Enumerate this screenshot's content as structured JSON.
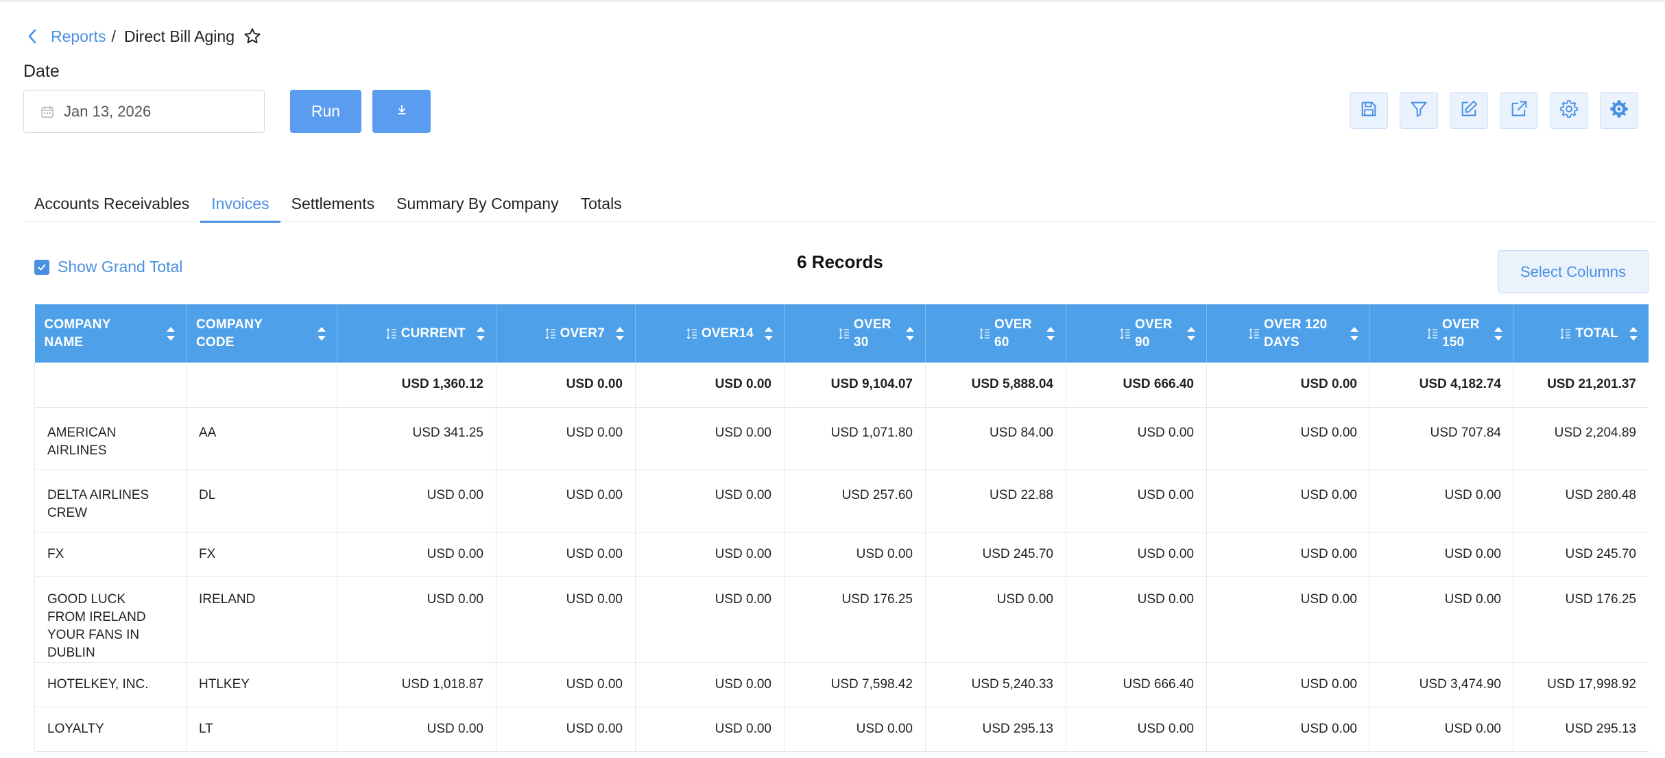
{
  "breadcrumb": {
    "parent": "Reports",
    "separator": "/",
    "current": "Direct Bill Aging"
  },
  "date": {
    "label": "Date",
    "value": "Jan 13, 2026"
  },
  "buttons": {
    "run": "Run"
  },
  "toolbar": [
    "save-icon",
    "filter-icon",
    "edit-icon",
    "external-link-icon",
    "gear-icon",
    "gear-badge-icon"
  ],
  "tabs": [
    {
      "label": "Accounts Receivables",
      "active": false
    },
    {
      "label": "Invoices",
      "active": true
    },
    {
      "label": "Settlements",
      "active": false
    },
    {
      "label": "Summary By Company",
      "active": false
    },
    {
      "label": "Totals",
      "active": false
    }
  ],
  "grand_total": {
    "label": "Show Grand Total",
    "checked": true
  },
  "records": "6 Records",
  "select_columns": "Select Columns",
  "colors": {
    "accent": "#4a90e2",
    "header_bg": "#4ea1e8",
    "button_bg": "#5a9cf0"
  },
  "table": {
    "columns": [
      {
        "label": "COMPANY NAME",
        "numeric": false
      },
      {
        "label": "COMPANY CODE",
        "numeric": false
      },
      {
        "label": "CURRENT",
        "numeric": true
      },
      {
        "label": "OVER7",
        "numeric": true
      },
      {
        "label": "OVER14",
        "numeric": true
      },
      {
        "label": "OVER 30",
        "numeric": true
      },
      {
        "label": "OVER 60",
        "numeric": true
      },
      {
        "label": "OVER 90",
        "numeric": true
      },
      {
        "label": "OVER 120 DAYS",
        "numeric": true
      },
      {
        "label": "OVER 150",
        "numeric": true
      },
      {
        "label": "TOTAL",
        "numeric": true
      }
    ],
    "totals": [
      "",
      "",
      "USD 1,360.12",
      "USD 0.00",
      "USD 0.00",
      "USD 9,104.07",
      "USD 5,888.04",
      "USD 666.40",
      "USD 0.00",
      "USD 4,182.74",
      "USD 21,201.37"
    ],
    "rows": [
      [
        "AMERICAN AIRLINES",
        "AA",
        "USD 341.25",
        "USD 0.00",
        "USD 0.00",
        "USD 1,071.80",
        "USD 84.00",
        "USD 0.00",
        "USD 0.00",
        "USD 707.84",
        "USD 2,204.89"
      ],
      [
        "DELTA AIRLINES CREW",
        "DL",
        "USD 0.00",
        "USD 0.00",
        "USD 0.00",
        "USD 257.60",
        "USD 22.88",
        "USD 0.00",
        "USD 0.00",
        "USD 0.00",
        "USD 280.48"
      ],
      [
        "FX",
        "FX",
        "USD 0.00",
        "USD 0.00",
        "USD 0.00",
        "USD 0.00",
        "USD 245.70",
        "USD 0.00",
        "USD 0.00",
        "USD 0.00",
        "USD 245.70"
      ],
      [
        "GOOD LUCK FROM IRELAND YOUR FANS IN DUBLIN",
        "IRELAND",
        "USD 0.00",
        "USD 0.00",
        "USD 0.00",
        "USD 176.25",
        "USD 0.00",
        "USD 0.00",
        "USD 0.00",
        "USD 0.00",
        "USD 176.25"
      ],
      [
        "HOTELKEY, INC.",
        "HTLKEY",
        "USD 1,018.87",
        "USD 0.00",
        "USD 0.00",
        "USD 7,598.42",
        "USD 5,240.33",
        "USD 666.40",
        "USD 0.00",
        "USD 3,474.90",
        "USD 17,998.92"
      ],
      [
        "LOYALTY",
        "LT",
        "USD 0.00",
        "USD 0.00",
        "USD 0.00",
        "USD 0.00",
        "USD 295.13",
        "USD 0.00",
        "USD 0.00",
        "USD 0.00",
        "USD 295.13"
      ]
    ]
  }
}
